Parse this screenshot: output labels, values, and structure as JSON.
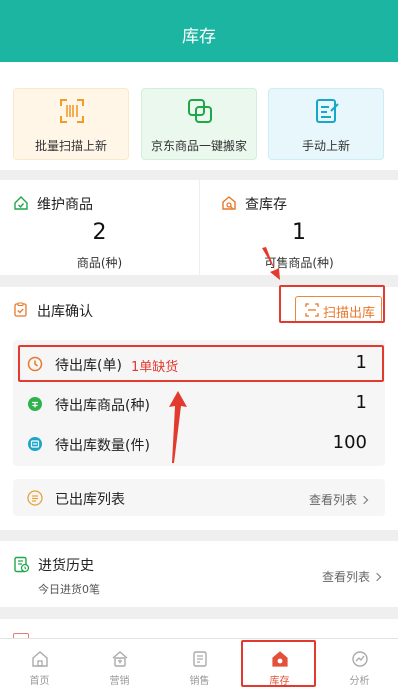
{
  "header": {
    "title": "库存"
  },
  "quick_actions": [
    {
      "label": "批量扫描上新",
      "icon": "barcode-scan-icon",
      "color": "#f39a2c"
    },
    {
      "label": "京东商品一键搬家",
      "icon": "copy-transfer-icon",
      "color": "#1fa74a"
    },
    {
      "label": "手动上新",
      "icon": "edit-document-icon",
      "color": "#1aa6c9"
    }
  ],
  "stats": [
    {
      "name": "维护商品",
      "value": "2",
      "unit": "商品(种)",
      "icon": "house-check-icon"
    },
    {
      "name": "查库存",
      "value": "1",
      "unit": "可售商品(种)",
      "icon": "inventory-search-icon"
    }
  ],
  "outbound": {
    "title": "出库确认",
    "icon": "clipboard-check-icon",
    "scan_button": "扫描出库",
    "rows": [
      {
        "label": "待出库(单)",
        "warning": "1单缺货",
        "value": "1",
        "icon": "clock-icon"
      },
      {
        "label": "待出库商品(种)",
        "warning": "",
        "value": "1",
        "icon": "product-icon"
      },
      {
        "label": "待出库数量(件)",
        "warning": "",
        "value": "100",
        "icon": "quantity-icon"
      }
    ],
    "list": {
      "label": "已出库列表",
      "link": "查看列表",
      "icon": "list-icon"
    }
  },
  "history": {
    "title": "进货历史",
    "subtitle": "今日进货0笔",
    "link": "查看列表",
    "icon": "receipt-icon"
  },
  "tabs": [
    {
      "label": "首页",
      "icon": "home-icon",
      "active": false
    },
    {
      "label": "营销",
      "icon": "marketing-icon",
      "active": false
    },
    {
      "label": "销售",
      "icon": "sales-icon",
      "active": false
    },
    {
      "label": "库存",
      "icon": "inventory-icon",
      "active": true
    },
    {
      "label": "分析",
      "icon": "analytics-icon",
      "active": false
    }
  ],
  "colors": {
    "brand": "#1cb5a2",
    "accent_orange": "#e8782a",
    "annotation_red": "#e23a2e",
    "active_tab": "#e2523a"
  }
}
